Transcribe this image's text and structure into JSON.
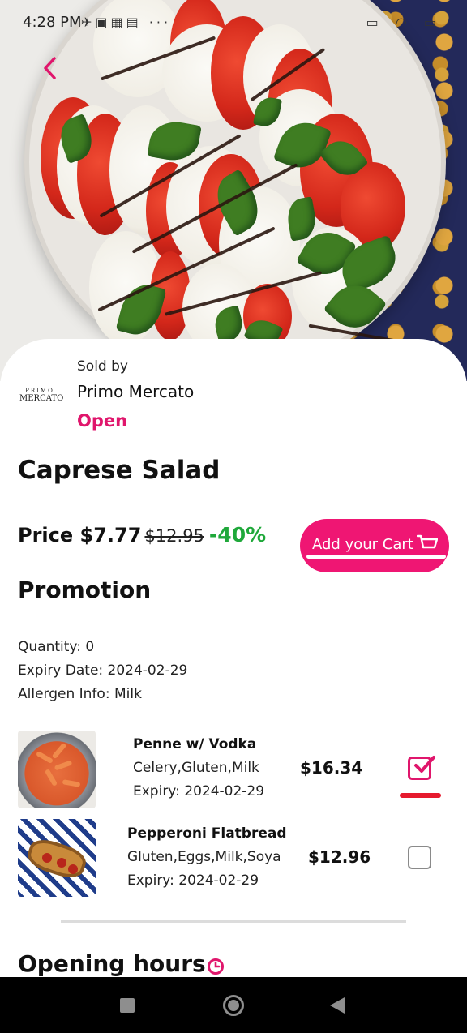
{
  "status_bar": {
    "time": "4:28 PM"
  },
  "seller": {
    "sold_by_label": "Sold by",
    "name": "Primo Mercato",
    "status": "Open",
    "logo_line1": "PRIMO",
    "logo_line2": "MERCATO"
  },
  "product": {
    "title": "Caprese Salad",
    "price_label": "Price $7.77",
    "original_price": "$12.95",
    "discount": "-40%"
  },
  "cart_button": {
    "label": "Add your Cart"
  },
  "promotion": {
    "title": "Promotion",
    "quantity": "Quantity: 0",
    "expiry": "Expiry Date: 2024-02-29",
    "allergen": "Allergen Info: Milk"
  },
  "items": [
    {
      "name": "Penne w/ Vodka",
      "allergens": "Celery,Gluten,Milk",
      "expiry": "Expiry: 2024-02-29",
      "price": "$16.34",
      "checked": true
    },
    {
      "name": "Pepperoni Flatbread",
      "allergens": "Gluten,Eggs,Milk,Soya",
      "expiry": "Expiry: 2024-02-29",
      "price": "$12.96",
      "checked": false
    }
  ],
  "opening_hours": {
    "title": "Opening hours"
  },
  "colors": {
    "accent": "#e0166c",
    "discount": "#1fa83a",
    "button": "#ef1673"
  }
}
